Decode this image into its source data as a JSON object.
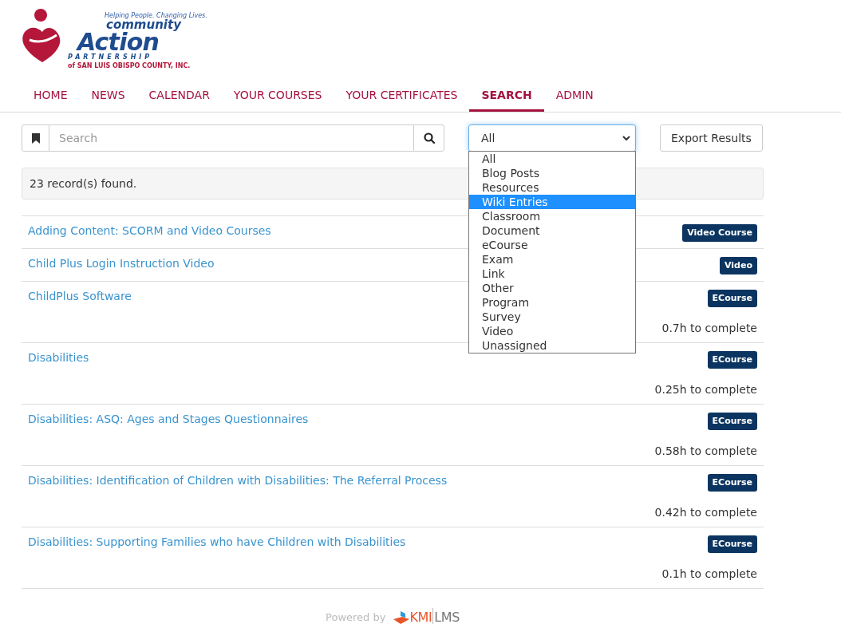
{
  "logo": {
    "tagline": "Helping People. Changing Lives.",
    "line1": "community",
    "line2": "Action",
    "line3": "PARTNERSHIP",
    "line4": "of SAN LUIS OBISPO COUNTY, INC."
  },
  "nav": [
    {
      "label": "HOME",
      "selected": false
    },
    {
      "label": "NEWS",
      "selected": false
    },
    {
      "label": "CALENDAR",
      "selected": false
    },
    {
      "label": "YOUR COURSES",
      "selected": false
    },
    {
      "label": "YOUR CERTIFICATES",
      "selected": false
    },
    {
      "label": "SEARCH",
      "selected": true
    },
    {
      "label": "ADMIN",
      "selected": false
    }
  ],
  "search": {
    "placeholder": "Search"
  },
  "filter": {
    "value": "All",
    "expanded": true,
    "options": [
      {
        "label": "All",
        "highlighted": false
      },
      {
        "label": "Blog Posts",
        "highlighted": false
      },
      {
        "label": "Resources",
        "highlighted": false
      },
      {
        "label": "Wiki Entries",
        "highlighted": true
      },
      {
        "label": "Classroom",
        "highlighted": false
      },
      {
        "label": "Document",
        "highlighted": false
      },
      {
        "label": "eCourse",
        "highlighted": false
      },
      {
        "label": "Exam",
        "highlighted": false
      },
      {
        "label": "Link",
        "highlighted": false
      },
      {
        "label": "Other",
        "highlighted": false
      },
      {
        "label": "Program",
        "highlighted": false
      },
      {
        "label": "Survey",
        "highlighted": false
      },
      {
        "label": "Video",
        "highlighted": false
      },
      {
        "label": "Unassigned",
        "highlighted": false
      }
    ]
  },
  "export_button": "Export Results",
  "records_found": "23 record(s) found.",
  "results": [
    {
      "title": "Adding Content: SCORM and Video Courses",
      "badge": "Video Course"
    },
    {
      "title": "Child Plus Login Instruction Video",
      "badge": "Video"
    },
    {
      "title": "ChildPlus Software",
      "badge": "ECourse",
      "duration": "0.7h to complete"
    },
    {
      "title": "Disabilities",
      "badge": "ECourse",
      "duration": "0.25h to complete"
    },
    {
      "title": "Disabilities: ASQ: Ages and Stages Questionnaires",
      "badge": "ECourse",
      "duration": "0.58h to complete"
    },
    {
      "title": "Disabilities: Identification of Children with Disabilities: The Referral Process",
      "badge": "ECourse",
      "duration": "0.42h to complete"
    },
    {
      "title": "Disabilities: Supporting Families who have Children with Disabilities",
      "badge": "ECourse",
      "duration": "0.1h to complete"
    }
  ],
  "footer": {
    "powered_by": "Powered by",
    "brand_kmi": "KMI",
    "brand_lms": "LMS"
  }
}
